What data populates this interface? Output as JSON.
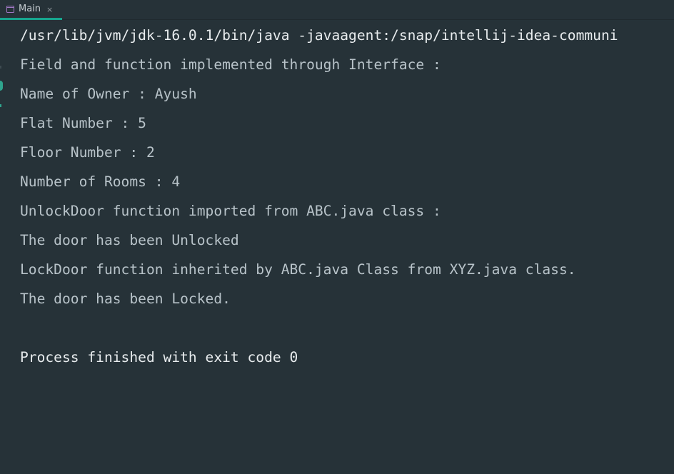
{
  "tab": {
    "icon": "console-window-icon",
    "label": "Main",
    "close_glyph": "×"
  },
  "console": {
    "command": "/usr/lib/jvm/jdk-16.0.1/bin/java -javaagent:/snap/intellij-idea-communi",
    "output": [
      "Field and function implemented through Interface :",
      "Name of Owner : Ayush",
      "Flat Number : 5",
      "Floor Number : 2",
      "Number of Rooms : 4",
      "UnlockDoor function imported from ABC.java class :",
      "The door has been Unlocked",
      "LockDoor function inherited by ABC.java Class from XYZ.java class.",
      "The door has been Locked."
    ],
    "blank": "",
    "exit_message": "Process finished with exit code 0"
  },
  "colors": {
    "background": "#263238",
    "tab_underline": "#17a68f",
    "output_text": "#b8c3c9",
    "command_text": "#e8ecee"
  }
}
